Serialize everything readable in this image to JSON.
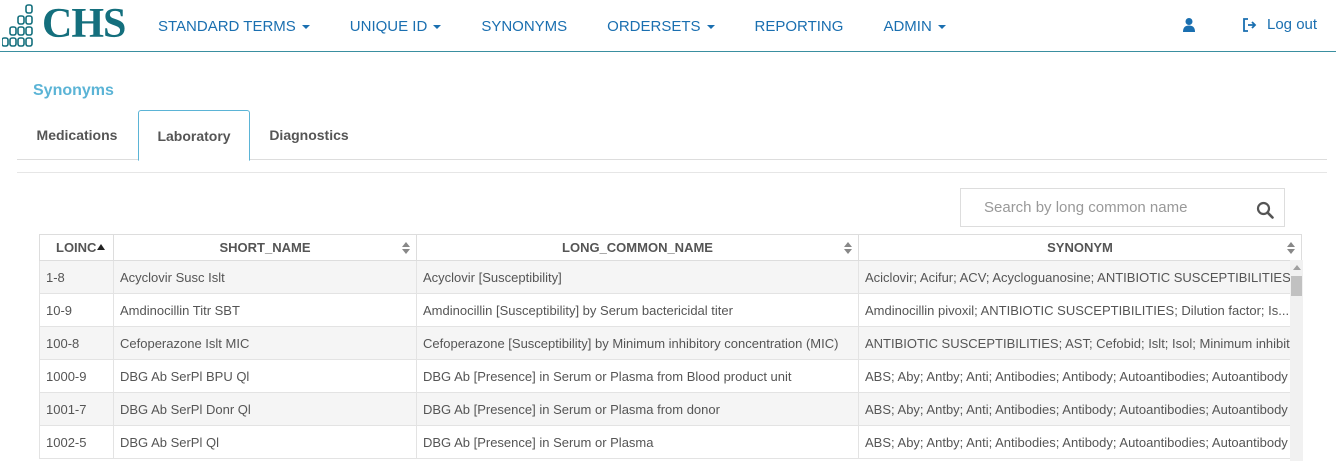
{
  "brand": {
    "name": "CHS",
    "color": "#146f7d"
  },
  "nav": {
    "items": [
      {
        "label": "STANDARD TERMS",
        "dropdown": true
      },
      {
        "label": "UNIQUE ID",
        "dropdown": true
      },
      {
        "label": "SYNONYMS",
        "dropdown": false
      },
      {
        "label": "ORDERSETS",
        "dropdown": true
      },
      {
        "label": "REPORTING",
        "dropdown": false
      },
      {
        "label": "ADMIN",
        "dropdown": true
      }
    ],
    "user_icon": "user-icon",
    "logout_label": "Log out",
    "logout_icon": "sign-out-icon"
  },
  "page": {
    "title": "Synonyms",
    "tabs": [
      {
        "label": "Medications",
        "active": false
      },
      {
        "label": "Laboratory",
        "active": true
      },
      {
        "label": "Diagnostics",
        "active": false
      }
    ]
  },
  "search": {
    "placeholder": "Search by long common name",
    "value": "",
    "icon": "search-icon"
  },
  "table": {
    "columns": [
      {
        "label": "LOINC",
        "sort": "asc"
      },
      {
        "label": "SHORT_NAME",
        "sort": "both"
      },
      {
        "label": "LONG_COMMON_NAME",
        "sort": "both"
      },
      {
        "label": "SYNONYM",
        "sort": "both"
      }
    ],
    "rows": [
      [
        "1-8",
        "Acyclovir Susc Islt",
        "Acyclovir [Susceptibility]",
        "Aciclovir; Acifur; ACV; Acycloguanosine; ANTIBIOTIC SUSCEPTIBILITIES; Aciclovir"
      ],
      [
        "10-9",
        "Amdinocillin Titr SBT",
        "Amdinocillin [Susceptibility] by Serum bactericidal titer",
        "Amdinocillin pivoxil; ANTIBIOTIC SUSCEPTIBILITIES; Dilution factor; Is..."
      ],
      [
        "100-8",
        "Cefoperazone Islt MIC",
        "Cefoperazone [Susceptibility] by Minimum inhibitory concentration (MIC)",
        "ANTIBIOTIC SUSCEPTIBILITIES; AST; Cefobid; Islt; Isol; Minimum inhibit..."
      ],
      [
        "1000-9",
        "DBG Ab SerPl BPU Ql",
        "DBG Ab [Presence] in Serum or Plasma from Blood product unit",
        "ABS; Aby; Antby; Anti; Antibodies; Antibody; Autoantibodies; Autoantibody"
      ],
      [
        "1001-7",
        "DBG Ab SerPl Donr Ql",
        "DBG Ab [Presence] in Serum or Plasma from donor",
        "ABS; Aby; Antby; Anti; Antibodies; Antibody; Autoantibodies; Autoantibody"
      ],
      [
        "1002-5",
        "DBG Ab SerPl Ql",
        "DBG Ab [Presence] in Serum or Plasma",
        "ABS; Aby; Antby; Anti; Antibodies; Antibody; Autoantibodies; Autoantibody"
      ]
    ]
  },
  "colors": {
    "link": "#1a6fb0",
    "title": "#5bb4d6",
    "tab_border": "#5bb4d6",
    "row_stripe": "#f5f5f5"
  }
}
